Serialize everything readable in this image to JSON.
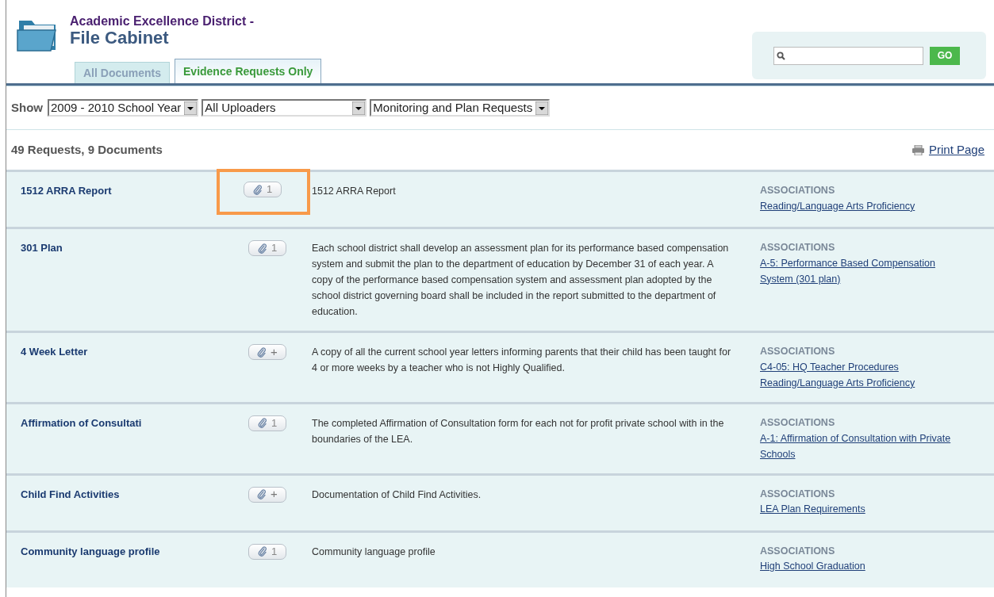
{
  "header": {
    "subtitle": "Academic Excellence District -",
    "title": "File Cabinet"
  },
  "tabs": [
    {
      "label": "All Documents",
      "selected": false
    },
    {
      "label": "Evidence Requests Only",
      "selected": true
    }
  ],
  "search": {
    "button": "GO"
  },
  "filters": {
    "label": "Show",
    "selects": [
      "2009 - 2010 School Year",
      "All Uploaders",
      "Monitoring and Plan Requests"
    ]
  },
  "summary": "49 Requests, 9 Documents",
  "print_link": "Print Page",
  "requests": [
    {
      "name": "1512 ARRA Report",
      "attachment": {
        "kind": "count",
        "label": "1"
      },
      "highlighted": true,
      "description": "1512 ARRA Report",
      "associations_heading": "ASSOCIATIONS",
      "associations": [
        "Reading/Language Arts Proficiency"
      ]
    },
    {
      "name": "301 Plan",
      "attachment": {
        "kind": "count",
        "label": "1"
      },
      "highlighted": false,
      "description": "Each school district shall develop an assessment plan for its performance based compensation system and submit the plan to the department of education by December 31 of each year. A copy of the performance based compensation system and assessment plan adopted by the school district governing board shall be included in the report submitted to the department of education.",
      "associations_heading": "ASSOCIATIONS",
      "associations": [
        "A-5: Performance Based Compensation System (301 plan)"
      ]
    },
    {
      "name": "4 Week Letter",
      "attachment": {
        "kind": "add",
        "label": "+"
      },
      "highlighted": false,
      "description": "A copy of all the current school year letters informing parents that their child has been taught for 4 or more weeks by a teacher who is not Highly Qualified.",
      "associations_heading": "ASSOCIATIONS",
      "associations": [
        "C4-05: HQ Teacher Procedures",
        "Reading/Language Arts Proficiency"
      ]
    },
    {
      "name": "Affirmation of Consultati",
      "attachment": {
        "kind": "count",
        "label": "1"
      },
      "highlighted": false,
      "description": "The completed Affirmation of Consultation form for each not for profit private school with in the boundaries of the LEA.",
      "associations_heading": "ASSOCIATIONS",
      "associations": [
        "A-1: Affirmation of Consultation with Private Schools"
      ]
    },
    {
      "name": "Child Find Activities",
      "attachment": {
        "kind": "add",
        "label": "+"
      },
      "highlighted": false,
      "description": "Documentation of Child Find Activities.",
      "associations_heading": "ASSOCIATIONS",
      "associations": [
        "LEA Plan Requirements"
      ]
    },
    {
      "name": "Community language profile",
      "attachment": {
        "kind": "count",
        "label": "1"
      },
      "highlighted": false,
      "description": "Community language profile",
      "associations_heading": "ASSOCIATIONS",
      "associations": [
        "High School Graduation"
      ]
    }
  ]
}
